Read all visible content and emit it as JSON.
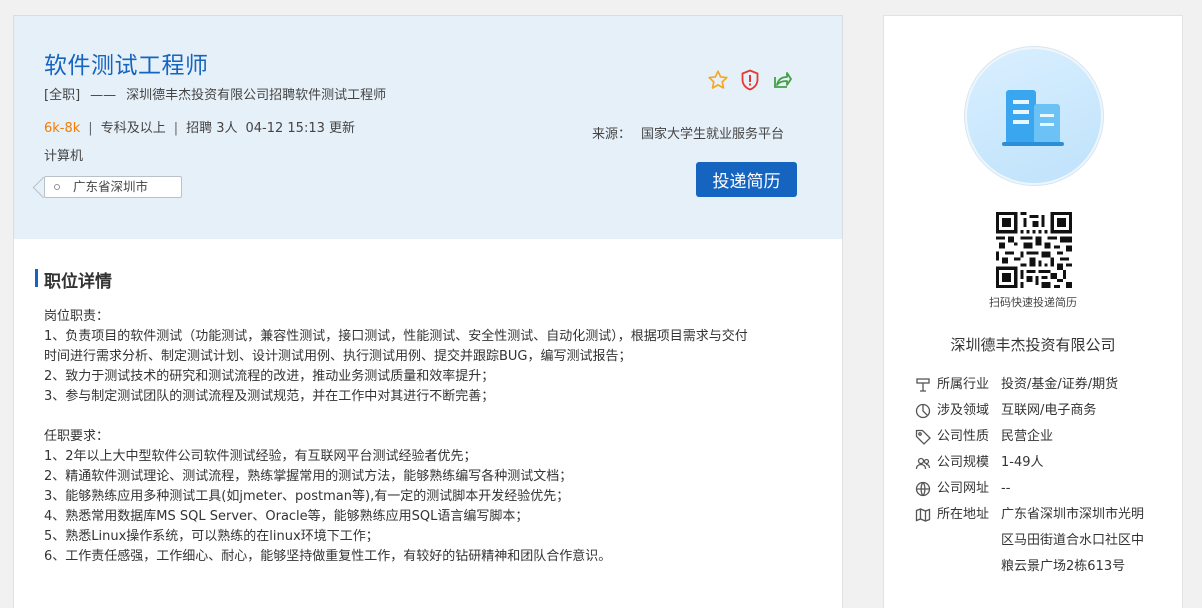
{
  "job": {
    "title": "软件测试工程师",
    "type": "[全职]",
    "dash": "——",
    "subtitle": "深圳德丰杰投资有限公司招聘软件测试工程师",
    "salary": "6k-8k",
    "education": "专科及以上",
    "hiring": "招聘 3人",
    "updated": "04-12 15:13 更新",
    "separator": "|",
    "major": "计算机",
    "location": "广东省深圳市",
    "source_label": "来源：",
    "source_value": "国家大学生就业服务平台",
    "apply_label": "投递简历"
  },
  "icons": {
    "favorite": "star-icon",
    "report": "report-shield-icon",
    "share": "share-icon"
  },
  "colors": {
    "accent": "#1565c0",
    "salary": "#f57c00",
    "star": "#f5a623",
    "report": "#e53935",
    "share": "#43a047"
  },
  "detail": {
    "section_title": "职位详情",
    "lines": [
      "岗位职责：",
      "1、负责项目的软件测试（功能测试，兼容性测试，接口测试，性能测试、安全性测试、自动化测试），根据项目需求与交付",
      "时间进行需求分析、制定测试计划、设计测试用例、执行测试用例、提交并跟踪BUG，编写测试报告；",
      "2、致力于测试技术的研究和测试流程的改进，推动业务测试质量和效率提升；",
      "3、参与制定测试团队的测试流程及测试规范，并在工作中对其进行不断完善；",
      "",
      "任职要求：",
      "1、2年以上大中型软件公司软件测试经验，有互联网平台测试经验者优先；",
      "2、精通软件测试理论、测试流程，熟练掌握常用的测试方法，能够熟练编写各种测试文档；",
      "3、能够熟练应用多种测试工具(如jmeter、postman等),有一定的测试脚本开发经验优先；",
      "4、熟悉常用数据库MS SQL Server、Oracle等，能够熟练应用SQL语言编写脚本；",
      "5、熟悉Linux操作系统，可以熟练的在linux环境下工作；",
      "6、工作责任感强，工作细心、耐心，能够坚持做重复性工作，有较好的钻研精神和团队合作意识。"
    ]
  },
  "company": {
    "qr_label": "扫码快速投递简历",
    "name": "深圳德丰杰投资有限公司",
    "info": [
      {
        "label": "所属行业",
        "value": "投资/基金/证券/期货",
        "icon": "industry-icon"
      },
      {
        "label": "涉及领域",
        "value": "互联网/电子商务",
        "icon": "pie-chart-icon"
      },
      {
        "label": "公司性质",
        "value": "民营企业",
        "icon": "tag-icon"
      },
      {
        "label": "公司规模",
        "value": "1-49人",
        "icon": "people-icon"
      },
      {
        "label": "公司网址",
        "value": "--",
        "icon": "globe-icon"
      },
      {
        "label": "所在地址",
        "value": "广东省深圳市深圳市光明区马田街道合水口社区中粮云景广场2栋613号",
        "icon": "map-icon"
      }
    ]
  }
}
